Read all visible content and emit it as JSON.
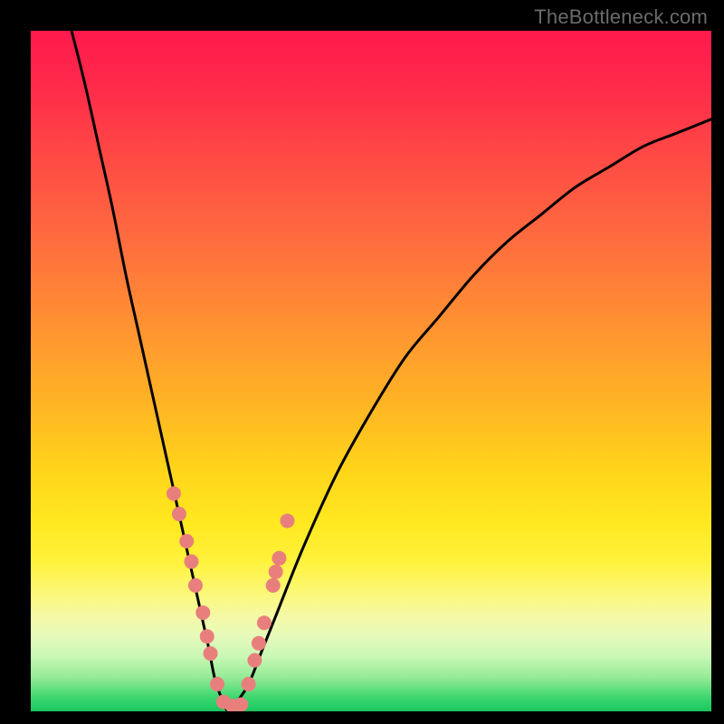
{
  "watermark": "TheBottleneck.com",
  "chart_data": {
    "type": "line",
    "title": "",
    "xlabel": "",
    "ylabel": "",
    "xlim": [
      0,
      100
    ],
    "ylim": [
      0,
      100
    ],
    "series": [
      {
        "name": "bottleneck-curve-left",
        "x": [
          6,
          8,
          10,
          12,
          14,
          16,
          18,
          20,
          22,
          24,
          26,
          27,
          28,
          29
        ],
        "values": [
          100,
          92,
          83,
          74,
          64,
          55,
          46,
          37,
          28,
          19,
          10,
          5,
          2,
          0
        ]
      },
      {
        "name": "bottleneck-curve-right",
        "x": [
          29,
          30,
          32,
          34,
          36,
          40,
          45,
          50,
          55,
          60,
          65,
          70,
          75,
          80,
          85,
          90,
          95,
          100
        ],
        "values": [
          0,
          1,
          4,
          9,
          14,
          24,
          35,
          44,
          52,
          58,
          64,
          69,
          73,
          77,
          80,
          83,
          85,
          87
        ]
      }
    ],
    "markers": {
      "name": "highlight-dots",
      "color": "#e97f7d",
      "x": [
        21.0,
        21.8,
        22.9,
        23.6,
        24.2,
        25.3,
        25.9,
        26.4,
        27.4,
        28.3,
        29.6,
        30.9,
        32.0,
        32.9,
        33.5,
        34.3,
        35.6,
        36.0,
        36.5,
        37.7
      ],
      "y": [
        32.0,
        29.0,
        25.0,
        22.0,
        18.5,
        14.5,
        11.0,
        8.5,
        4.0,
        1.4,
        0.8,
        1.0,
        4.0,
        7.5,
        10.0,
        13.0,
        18.5,
        20.5,
        22.5,
        28.0
      ]
    }
  }
}
